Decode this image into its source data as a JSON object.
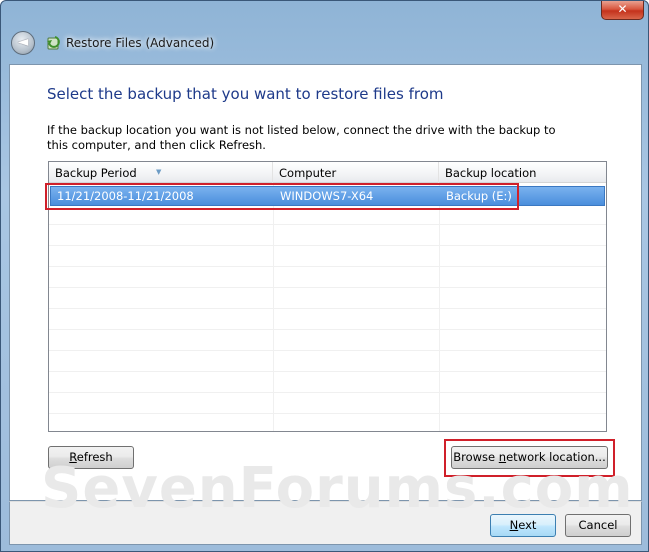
{
  "window": {
    "title": "Restore Files (Advanced)",
    "close_label": "✕",
    "back_label": "◄"
  },
  "main": {
    "heading": "Select the backup that you want to restore files from",
    "instructions": "If the backup location you want is not listed below, connect the drive with the backup to this computer, and then click Refresh."
  },
  "table": {
    "columns": [
      "Backup Period",
      "Computer",
      "Backup location"
    ],
    "rows": [
      {
        "period": "11/21/2008-11/21/2008",
        "computer": "WINDOWS7-X64",
        "location": "Backup (E:)",
        "selected": true
      }
    ]
  },
  "buttons": {
    "refresh_pre": "",
    "refresh_accel": "R",
    "refresh_post": "efresh",
    "browse_pre": "Browse ",
    "browse_accel": "n",
    "browse_post": "etwork location...",
    "next_pre": "",
    "next_accel": "N",
    "next_post": "ext",
    "cancel": "Cancel"
  },
  "watermark": "SevenForums.com",
  "colors": {
    "heading": "#1e3a8a",
    "selection": "#4a8edc",
    "annotation": "#d0202a"
  }
}
